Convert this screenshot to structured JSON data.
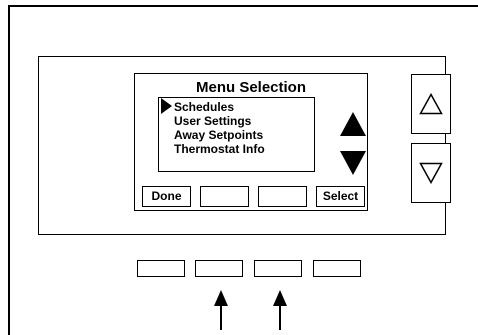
{
  "screen": {
    "title": "Menu Selection",
    "menu_items": [
      "Schedules",
      "User Settings",
      "Away Setpoints",
      "Thermostat Info"
    ],
    "selected_index": 0
  },
  "softkeys": [
    "Done",
    "",
    "",
    "Select"
  ],
  "icons": {
    "pointer": "selection-pointer-triangle",
    "scroll_up": "up-arrow-solid-triangle",
    "scroll_down": "down-arrow-solid-triangle",
    "up_button": "up-arrow-outline-triangle",
    "down_button": "down-arrow-outline-triangle",
    "callout": "upward-pointing-arrow"
  },
  "colors": {
    "line": "#000000",
    "background": "#ffffff"
  }
}
